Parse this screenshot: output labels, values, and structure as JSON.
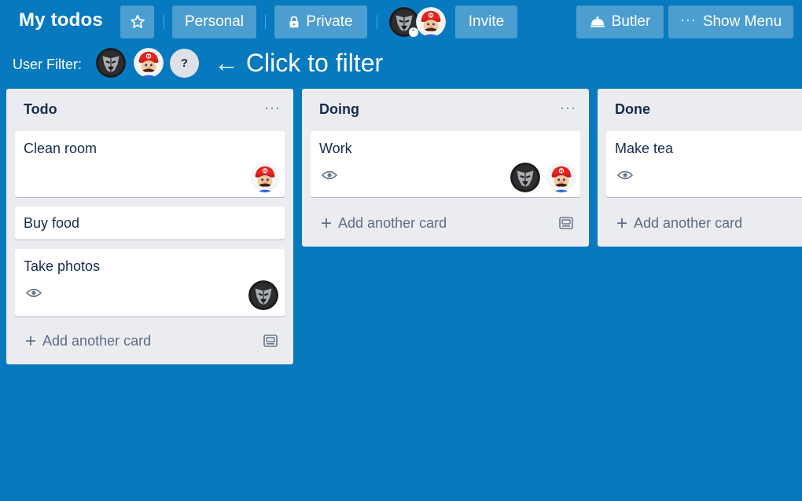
{
  "header": {
    "title": "My todos",
    "star_icon": "star-icon",
    "team_label": "Personal",
    "visibility_label": "Private",
    "invite_label": "Invite",
    "butler_label": "Butler",
    "menu_label": "Show Menu",
    "colors": {
      "background": "#0779bf",
      "button": "rgba(255,255,255,0.28)"
    }
  },
  "filter": {
    "label": "User Filter:",
    "help_label": "?",
    "hint": "← Click to filter",
    "members": [
      "decepticon-avatar",
      "mario-avatar"
    ]
  },
  "lists": [
    {
      "name": "Todo",
      "menu": "···",
      "cards": [
        {
          "title": "Clean room",
          "watched": false,
          "members": [
            "mario-avatar"
          ]
        },
        {
          "title": "Buy food",
          "watched": false,
          "members": []
        },
        {
          "title": "Take photos",
          "watched": true,
          "members": [
            "decepticon-avatar"
          ]
        }
      ],
      "add_label": "Add another card"
    },
    {
      "name": "Doing",
      "menu": "···",
      "cards": [
        {
          "title": "Work",
          "watched": true,
          "members": [
            "decepticon-avatar",
            "mario-avatar"
          ]
        }
      ],
      "add_label": "Add another card"
    },
    {
      "name": "Done",
      "cards": [
        {
          "title": "Make tea",
          "watched": true,
          "members": []
        }
      ],
      "add_label": "Add another card"
    }
  ]
}
